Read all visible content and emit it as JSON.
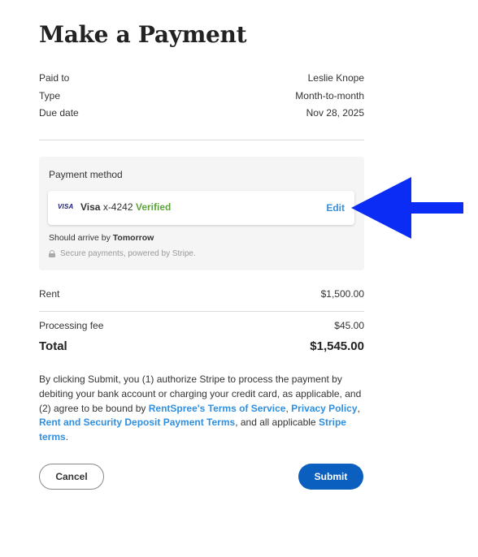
{
  "page": {
    "title": "Make a Payment"
  },
  "summary": [
    {
      "label": "Paid to",
      "value": "Leslie Knope"
    },
    {
      "label": "Type",
      "value": "Month-to-month"
    },
    {
      "label": "Due date",
      "value": "Nov 28, 2025"
    }
  ],
  "payment_method": {
    "label": "Payment method",
    "card_brand_icon": "visa-logo",
    "card_logo_text": "VISA",
    "card_brand": "Visa",
    "card_number": "x-4242",
    "status": "Verified",
    "edit_label": "Edit",
    "arrival_prefix": "Should arrive by",
    "arrival_value": "Tomorrow",
    "secure_icon": "lock-icon",
    "secure_text": "Secure payments, powered by Stripe."
  },
  "charges": {
    "rent_label": "Rent",
    "rent_value": "$1,500.00",
    "fee_label": "Processing fee",
    "fee_value": "$45.00",
    "total_label": "Total",
    "total_value": "$1,545.00"
  },
  "terms": {
    "part1": "By clicking Submit, you (1) authorize Stripe to process the payment by debiting your bank account or charging your credit card, as applicable, and (2) agree to be bound by ",
    "link_tos": "RentSpree's Terms of Service",
    "sep1": ", ",
    "link_privacy": "Privacy Policy",
    "sep2": ", ",
    "link_deposit": "Rent and Security Deposit Payment Terms",
    "part2": ", and all applicable ",
    "link_stripe": "Stripe terms",
    "part3": "."
  },
  "actions": {
    "cancel_label": "Cancel",
    "submit_label": "Submit"
  },
  "colors": {
    "accent": "#0b5fbf",
    "link": "#2f8fe0",
    "verified": "#5ea33a",
    "annotation": "#0a2cf5"
  }
}
